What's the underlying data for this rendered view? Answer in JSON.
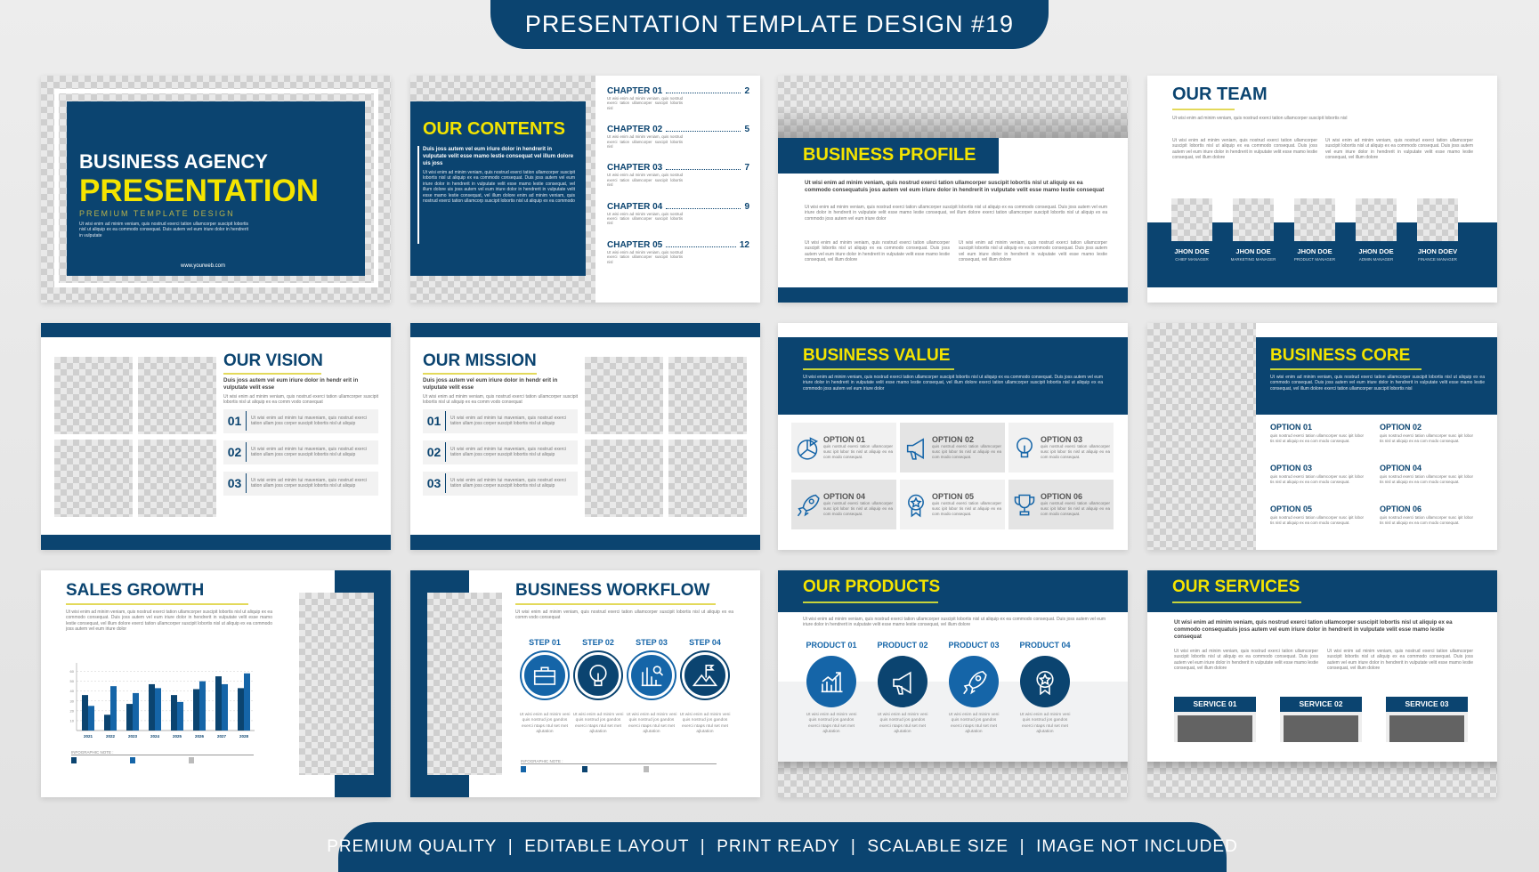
{
  "header": {
    "title": "PRESENTATION TEMPLATE DESIGN #19"
  },
  "footer": {
    "tagline": "PREMIUM QUALITY  |  EDITABLE LAYOUT  |  PRINT READY  |  SCALABLE SIZE  |  IMAGE NOT INCLUDED"
  },
  "colors": {
    "navy": "#0b4470",
    "yellow": "#f4e400",
    "blue": "#1565a8",
    "line": "#e3d95a"
  },
  "lorem": {
    "p1": "Ut wisi enim ad minim veniam, quis nostrud exerci tation ullamcorper suscipit lobortis nisl ut aliquip ex ea commodo consequat. Duis joss autem vel eum iriure dolor in hendrerit in vulputate velit esse mamo lestie consequat, vel illum dolore exerci tation ullamcorper suscipit lobortis nisl ut aliquip ex ea commodo joss autem vel eum iriure dolor",
    "p2": "Ut wisi enim ad minim veniam, quis nostrud exerci tation ullamcorper suscipit lobortis nisl ut aliquip ex ea commodo consequat. Duis joss autem vel eum iriure dolor in hendrerit in vulputate velit esse mamo lestie consequat, vel illum dolore",
    "bold": "Ut wisi enim ad minim veniam, quis nostrud exerci tation ullamcorper suscipit lobortis nisl ut aliquip ex ea commodo consequatuis joss autem vel eum iriure dolor in hendrerit in vulputate velit esse mamo lestie consequat",
    "short": "Ut wisi enim ad minim veniam, quis nostrud exerci tation ullamcorper suscipit lobortis nisl",
    "num": "Ut wisi enim ad minim tui maveniam, quis nostrud exerci tation ullam joss corper suscipit lobortis nisl ut aliquip",
    "opt": "quis nostrud exerci tation ullamcorper susc ipit lobor tis nisl ut aliquip ex ea com modo consequat.",
    "step": "Ut wisi enim ad minim veni quis nostrud jos gandos exerci ntaps ntul set met ajlutation",
    "vision_bold": "Duis joss autem vel eum iriure dolor in hendr erit in vulputate velit esse",
    "vision_p": "Ut wisi enim ad minim veniam, quis nostrud exerci tation ullamcorper suscipit lobortis nisl ut aliquip ex ea comm vodo consequat",
    "wf": "Ut wisi enim ad minim veniam, quis nostrud exerci tation ullamcorper suscipit lobortis nisl ut aliquip ex ea comm vodo consequat"
  },
  "cover": {
    "line1": "BUSINESS AGENCY",
    "line2": "PRESENTATION",
    "sub": "PREMIUM TEMPLATE DESIGN",
    "text": "Ut wisi enim ad minim veniam, quis nostrud exerci tation ullamcorper suscipit lobortis nisl ut aliquip ex ea commodo consequat. Duis autem vel eum iriure dolor in hendrerit in vulputate",
    "web": "www.yourweb.com"
  },
  "contents": {
    "title": "OUR CONTENTS",
    "bold": "Duis joss autem vel eum iriure dolor in hendrerit in vulputate velit esse mamo lestie consequat vel illum dolore uis joss",
    "text": "Ut wisi enim ad minim veniam, quis nostrud exerci tation ullamcorper suscipit lobortis nisl ut aliquip ex ea commodo consequat. Duis joss autem vel eum iriure dolor in hendrerit in vulputate velit esse mamo lestie consequat, vel illum dolore uis joss autem vel eum iriure dolor in hendrerit in vulputate velit esse mamo lestie consequat, vel illum dolore enim ad minim veniam, quis nostrud exerci tation ullamcorp suscipit lobortis nisl ut aliquip ex ea commodo",
    "chapters": [
      {
        "label": "CHAPTER 01",
        "page": "2"
      },
      {
        "label": "CHAPTER 02",
        "page": "5"
      },
      {
        "label": "CHAPTER 03",
        "page": "7"
      },
      {
        "label": "CHAPTER 04",
        "page": "9"
      },
      {
        "label": "CHAPTER 05",
        "page": "12"
      }
    ],
    "chapter_text": "Ut wisi enim ad minim veniam, quis nostrud exerci tation ullamcorper suscipit lobortis nisl"
  },
  "profile": {
    "title": "BUSINESS PROFILE"
  },
  "team": {
    "title": "OUR TEAM",
    "members": [
      {
        "name": "JHON DOE",
        "role": "CHIEF MANAGER"
      },
      {
        "name": "JHON DOE",
        "role": "MARKETING MANAGER"
      },
      {
        "name": "JHON DOE",
        "role": "PRODUCT MANAGER"
      },
      {
        "name": "JHON DOE",
        "role": "ADMIN MANAGER"
      },
      {
        "name": "JHON DOEV",
        "role": "FINANCE MANAGER"
      }
    ]
  },
  "vision": {
    "title": "OUR VISION",
    "nums": [
      "01",
      "02",
      "03"
    ]
  },
  "mission": {
    "title": "OUR MISSION",
    "nums": [
      "01",
      "02",
      "03"
    ]
  },
  "value": {
    "title": "BUSINESS VALUE",
    "options": [
      {
        "label": "OPTION 01",
        "icon": "pie-chart-icon"
      },
      {
        "label": "OPTION 02",
        "icon": "megaphone-icon"
      },
      {
        "label": "OPTION 03",
        "icon": "lightbulb-icon"
      },
      {
        "label": "OPTION 04",
        "icon": "rocket-icon"
      },
      {
        "label": "OPTION 05",
        "icon": "medal-icon"
      },
      {
        "label": "OPTION 06",
        "icon": "trophy-icon"
      }
    ]
  },
  "core": {
    "title": "BUSINESS CORE",
    "text": "Ut wisi enim ad minim veniam, quis nostrud exerci tation ullamcorper suscipit lobortis nisl ut aliquip ex ea commodo consequat. Duis joss autem vel eum iriure dolor in hendrerit in vulputate velit esse mamo lestie consequat, vel illum dolore exerci tation ullamcorper suscipit lobortis nisl",
    "options": [
      "OPTION 01",
      "OPTION 02",
      "OPTION 03",
      "OPTION 04",
      "OPTION 05",
      "OPTION 06"
    ]
  },
  "sales": {
    "title": "SALES GROWTH",
    "note": "INFOGRAPHIC NOTE :"
  },
  "workflow": {
    "title": "BUSINESS WORKFLOW",
    "steps": [
      {
        "label": "STEP 01",
        "icon": "briefcase-icon"
      },
      {
        "label": "STEP 02",
        "icon": "lightbulb-icon"
      },
      {
        "label": "STEP 03",
        "icon": "chart-search-icon"
      },
      {
        "label": "STEP 04",
        "icon": "mountain-flag-icon"
      }
    ],
    "note": "INFOGRAPHIC NOTE :"
  },
  "products": {
    "title": "OUR PRODUCTS",
    "items": [
      {
        "label": "PRODUCT 01",
        "icon": "growth-chart-icon"
      },
      {
        "label": "PRODUCT 02",
        "icon": "megaphone-icon"
      },
      {
        "label": "PRODUCT 03",
        "icon": "rocket-icon"
      },
      {
        "label": "PRODUCT 04",
        "icon": "medal-icon"
      }
    ]
  },
  "services": {
    "title": "OUR SERVICES",
    "items": [
      "SERVICE 01",
      "SERVICE 02",
      "SERVICE 03"
    ]
  },
  "chart_data": {
    "type": "bar",
    "categories": [
      "2021",
      "2022",
      "2023",
      "2024",
      "2025",
      "2026",
      "2027",
      "2028"
    ],
    "series": [
      {
        "values": [
          36,
          16,
          27,
          47,
          36,
          42,
          55,
          43
        ],
        "color": "#0b4470"
      },
      {
        "values": [
          25,
          45,
          38,
          43,
          29,
          50,
          47,
          58
        ],
        "color": "#1565a8"
      }
    ],
    "yticks": [
      10,
      20,
      30,
      40,
      50,
      60
    ],
    "ylim": [
      0,
      65
    ],
    "grid": true,
    "title": "",
    "xlabel": "",
    "ylabel": ""
  }
}
